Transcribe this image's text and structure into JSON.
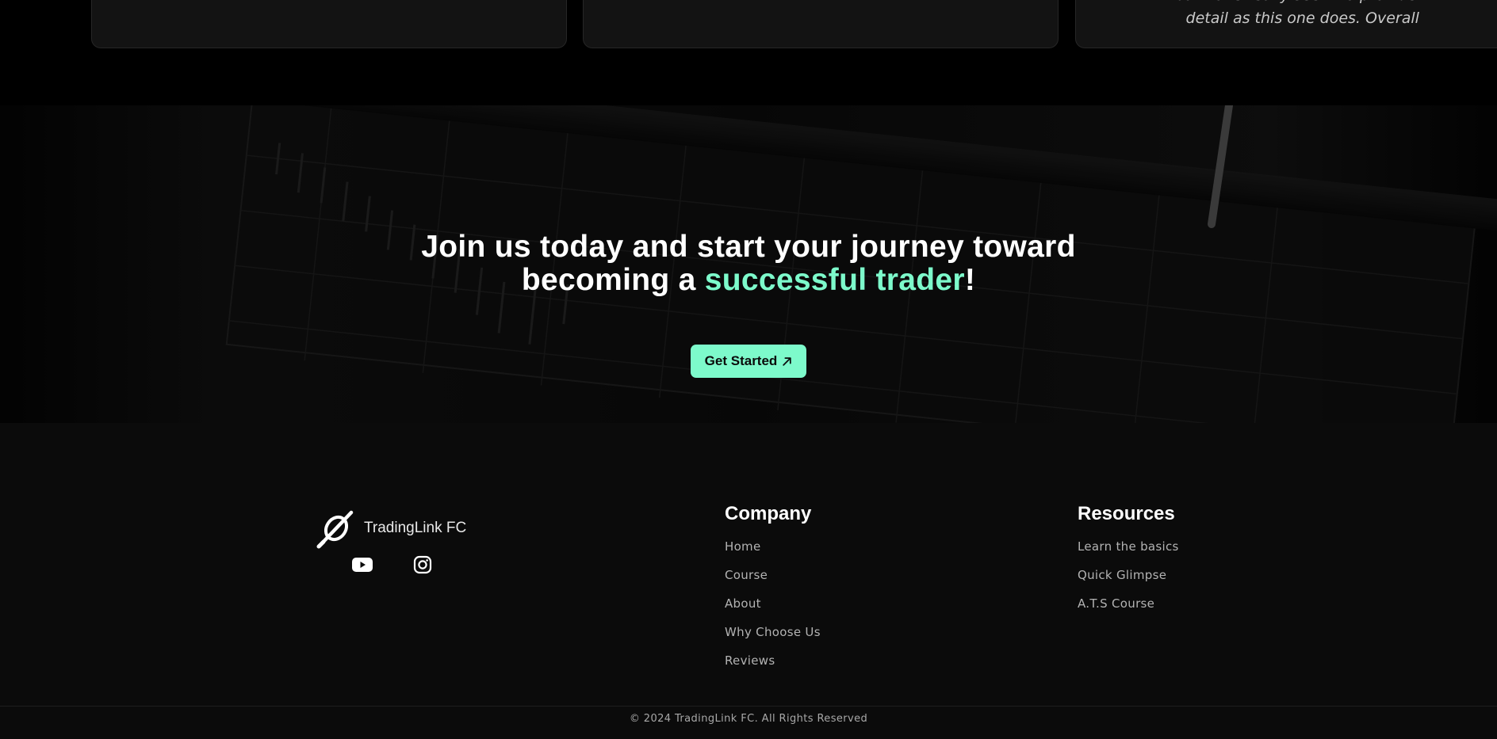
{
  "reviews": {
    "card3_text_lines": [
      "but none really seem to provide as much c",
      "detail as this one does. Overall really so"
    ]
  },
  "cta": {
    "heading_line1": "Join us today and start your journey toward",
    "heading_prefix": "becoming a ",
    "heading_accent": "successful trader",
    "heading_suffix": "!",
    "button_label": "Get Started",
    "accent_color": "#7dfacb"
  },
  "footer": {
    "brand_name": "TradingLink FC",
    "socials": [
      {
        "icon": "youtube-icon"
      },
      {
        "icon": "instagram-icon"
      }
    ],
    "company": {
      "title": "Company",
      "links": [
        "Home",
        "Course",
        "About",
        "Why Choose Us",
        "Reviews"
      ]
    },
    "resources": {
      "title": "Resources",
      "links": [
        "Learn the basics",
        "Quick Glimpse",
        "A.T.S Course"
      ]
    },
    "copyright": "© 2024 TradingLink FC. All Rights Reserved"
  }
}
